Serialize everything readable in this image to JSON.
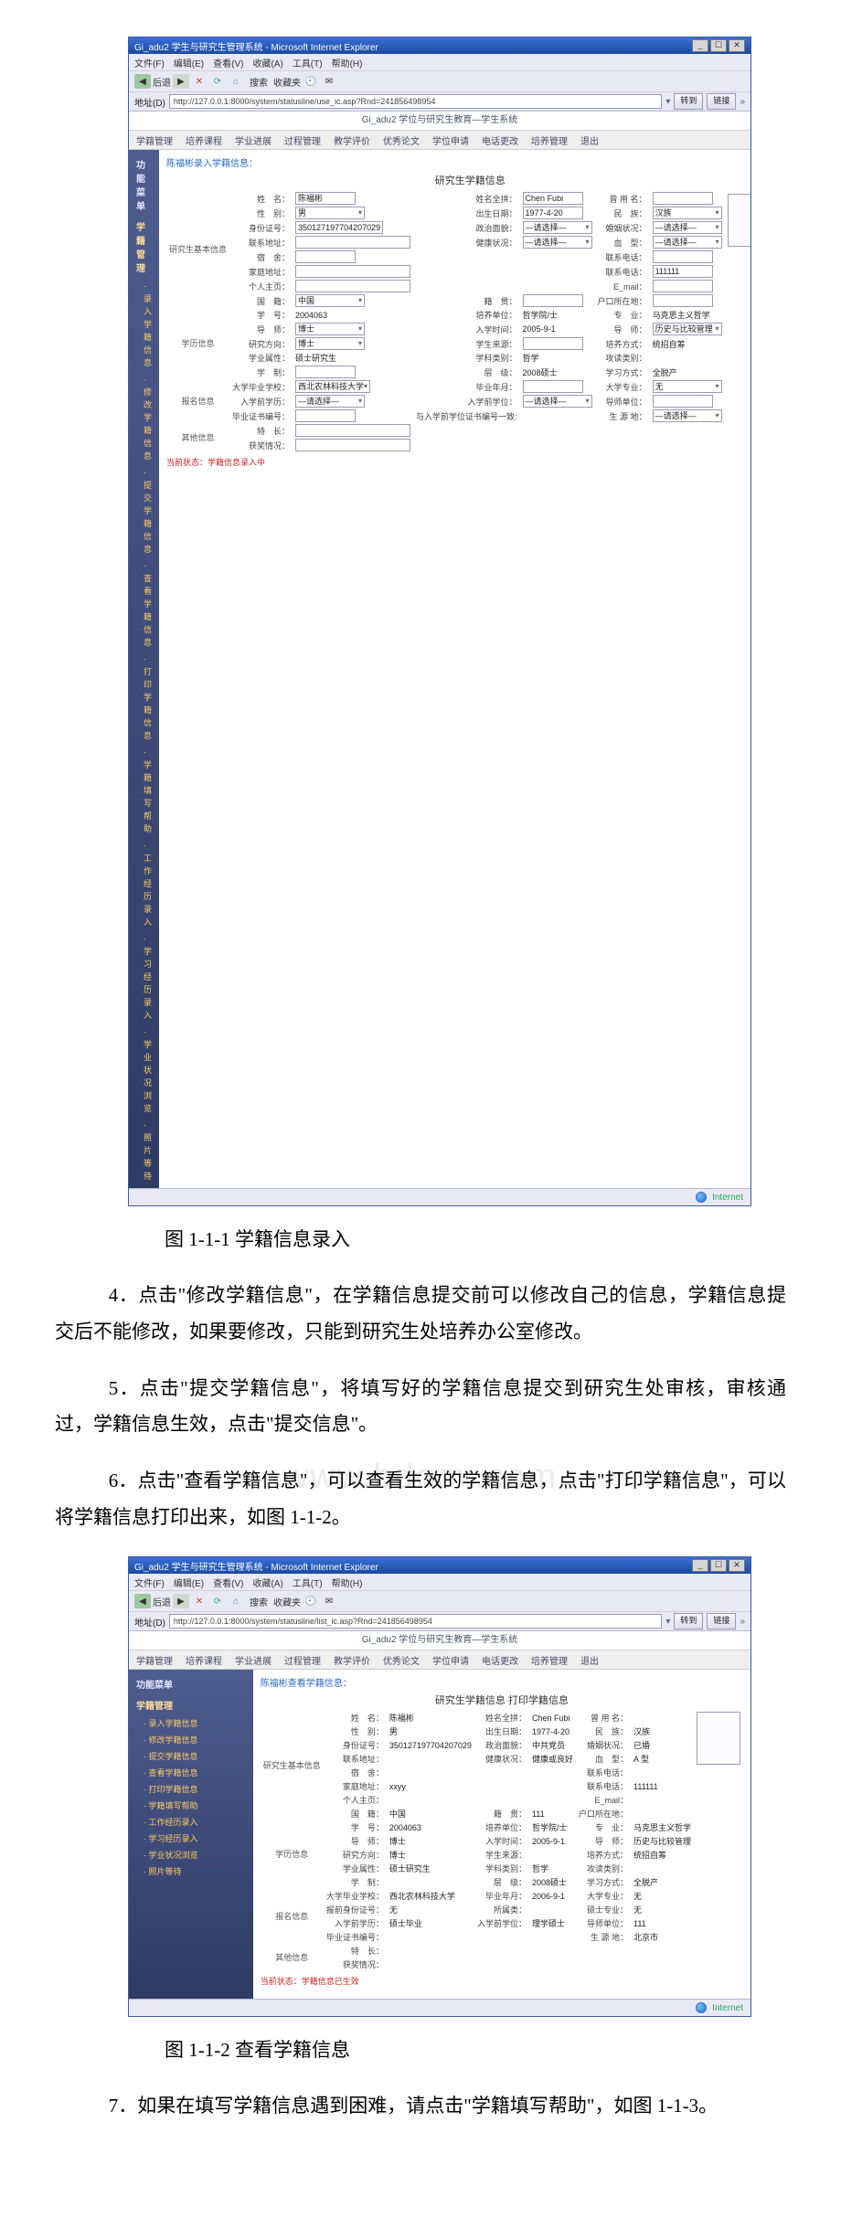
{
  "watermark": "www.bdocx.com",
  "captions": {
    "fig1": "图 1-1-1 学籍信息录入",
    "fig2": "图 1-1-2 查看学籍信息"
  },
  "paragraphs": {
    "p4": "4．点击\"修改学籍信息\"，在学籍信息提交前可以修改自己的信息，学籍信息提交后不能修改，如果要修改，只能到研究生处培养办公室修改。",
    "p5": "5．点击\"提交学籍信息\"，将填写好的学籍信息提交到研究生处审核，审核通过，学籍信息生效，点击\"提交信息\"。",
    "p6": "6．点击\"查看学籍信息\"，可以查看生效的学籍信息，点击\"打印学籍信息\"，可以将学籍信息打印出来，如图 1-1-2。",
    "p7": "7．如果在填写学籍信息遇到困难，请点击\"学籍填写帮助\"，如图 1-1-3。"
  },
  "shot_common": {
    "title": "Gi_adu2 学生与研究生管理系统 - Microsoft Internet Explorer",
    "menus": [
      "文件(F)",
      "编辑(E)",
      "查看(V)",
      "收藏(A)",
      "工具(T)",
      "帮助(H)"
    ],
    "toolbar": [
      "后退",
      "·",
      "⟳",
      "⟲",
      "✕",
      "搜索",
      "收藏夹",
      "·",
      "·",
      "·"
    ],
    "addr_label": "地址(D)",
    "go_btn": "转到",
    "links_btn": "链接",
    "subheader": "Gi_adu2 学位与研究生教育—学生系统",
    "tabs": [
      "学籍管理",
      "培养课程",
      "学业进展",
      "过程管理",
      "教学评价",
      "优秀论文",
      "学位申请",
      "电话更改",
      "培养管理",
      "退出"
    ],
    "sidebar_title": "功能菜单",
    "statusbar": "Internet"
  },
  "shot1": {
    "topnote": "陈福彬录入学籍信息：",
    "sidebar_group": "学籍管理",
    "sidebar_items": [
      "录入学籍信息",
      "修改学籍信息",
      "提交学籍信息",
      "查看学籍信息",
      "打印学籍信息",
      "学籍填写帮助",
      "工作经历录入",
      "学习经历录入",
      "学业状况浏览",
      "照片等待"
    ],
    "form_title": "研究生学籍信息",
    "row_labels": {
      "vl1": "研究生基本信息",
      "vl2": "学历信息",
      "vl3": "报名信息",
      "vl4": "其他信息"
    },
    "rows": [
      [
        [
          "姓　名：",
          "陈福彬",
          "input"
        ],
        [
          "姓名全拼：",
          "Chen Fubi",
          "input"
        ],
        [
          "曾 用 名：",
          "",
          "input"
        ]
      ],
      [
        [
          "性　别：",
          "男",
          "select"
        ],
        [
          "出生日期：",
          "1977-4-20",
          "input"
        ],
        [
          "民　族：",
          "汉族",
          "select"
        ]
      ],
      [
        [
          "身份证号：",
          "350127197704207029",
          "input"
        ],
        [
          "政治面貌：",
          "—请选择—",
          "select"
        ],
        [
          "婚姻状况：",
          "—请选择—",
          "select"
        ]
      ],
      [
        [
          "联系地址：",
          "",
          "input-wide"
        ],
        [
          "健康状况：",
          "—请选择—",
          "select"
        ],
        [
          "血　型：",
          "—请选择—",
          "select"
        ]
      ],
      [
        [
          "宿　舍：",
          "",
          "input"
        ],
        [
          "",
          "",
          ""
        ],
        [
          "联系电话：",
          "",
          "input"
        ]
      ],
      [
        [
          "家庭地址：",
          "",
          "input-wide"
        ],
        [
          "",
          "",
          ""
        ],
        [
          "联系电话：",
          "111111",
          "input"
        ]
      ],
      [
        [
          "个人主页：",
          "",
          "input-wide"
        ],
        [
          "",
          "",
          ""
        ],
        [
          "E_mail：",
          "",
          "input"
        ]
      ],
      [
        [
          "国　籍：",
          "中国",
          "select"
        ],
        [
          "籍　贯：",
          "",
          "input"
        ],
        [
          "户口所在地：",
          "",
          "input"
        ]
      ],
      [
        [
          "学　号：",
          "2004063",
          "text"
        ],
        [
          "培养单位：",
          "哲学院/士",
          "text"
        ],
        [
          "专　业：",
          "马克思主义哲学",
          "text"
        ]
      ],
      [
        [
          "导　师：",
          "博士",
          "select"
        ],
        [
          "入学时间：",
          "2005-9-1",
          "text"
        ],
        [
          "导　师：",
          "历史与比较管理",
          "select"
        ]
      ],
      [
        [
          "研究方向：",
          "博士",
          "select"
        ],
        [
          "学生来源：",
          "",
          "input"
        ],
        [
          "培养方式：",
          "统招自筹",
          "text"
        ]
      ],
      [
        [
          "学业属性：",
          "硕士研究生",
          "text"
        ],
        [
          "学科类别：",
          "哲学",
          "text"
        ],
        [
          "攻读类别：",
          "",
          "text"
        ]
      ],
      [
        [
          "学　制：",
          "",
          "input"
        ],
        [
          "层　级：",
          "2008硕士",
          "text"
        ],
        [
          "学习方式：",
          "全脱产",
          "text"
        ]
      ],
      [
        [
          "大学毕业学校：",
          "西北农林科技大学",
          "select"
        ],
        [
          "毕业年月：",
          "",
          "input"
        ],
        [
          "大学专业：",
          "无",
          "select"
        ]
      ],
      [
        [
          "入学前学历：",
          "—请选择—",
          "select"
        ],
        [
          "入学前学位：",
          "—请选择—",
          "select"
        ],
        [
          "导师单位：",
          "",
          "input"
        ]
      ],
      [
        [
          "毕业证书编号：",
          "",
          "input"
        ],
        [
          "与入学前学位证书编号一致:",
          "",
          "text"
        ],
        [
          "生 源 地：",
          "—请选择—",
          "select"
        ]
      ],
      [
        [
          "特　长：",
          "",
          "input-wide"
        ],
        [
          "",
          "",
          ""
        ],
        [
          "",
          "",
          ""
        ]
      ],
      [
        [
          "获奖情况：",
          "",
          "input-wide"
        ],
        [
          "",
          "",
          ""
        ],
        [
          "",
          "",
          ""
        ]
      ]
    ],
    "bottom_note": "当前状态：学籍信息录入中"
  },
  "shot2": {
    "topnote": "陈福彬查看学籍信息：",
    "sidebar_group": "学籍管理",
    "sidebar_items": [
      "录入学籍信息",
      "修改学籍信息",
      "提交学籍信息",
      "查看学籍信息",
      "打印学籍信息",
      "学籍填写帮助",
      "工作经历录入",
      "学习经历录入",
      "学业状况浏览",
      "照片等待"
    ],
    "form_title": "研究生学籍信息 打印学籍信息",
    "row_labels": {
      "vl1": "研究生基本信息",
      "vl2": "学历信息",
      "vl3": "报名信息",
      "vl4": "其他信息"
    },
    "rows": [
      [
        [
          "姓　名：",
          "陈福彬"
        ],
        [
          "姓名全拼：",
          "Chen Fubi"
        ],
        [
          "曾 用 名：",
          ""
        ]
      ],
      [
        [
          "性　别：",
          "男"
        ],
        [
          "出生日期：",
          "1977-4-20"
        ],
        [
          "民　族：",
          "汉族"
        ]
      ],
      [
        [
          "身份证号：",
          "350127197704207029"
        ],
        [
          "政治面貌：",
          "中共党员"
        ],
        [
          "婚姻状况：",
          "已婚"
        ]
      ],
      [
        [
          "联系地址：",
          ""
        ],
        [
          "健康状况：",
          "健康或良好"
        ],
        [
          "血　型：",
          "A 型"
        ]
      ],
      [
        [
          "宿　舍：",
          ""
        ],
        [
          "",
          ""
        ],
        [
          "联系电话：",
          ""
        ]
      ],
      [
        [
          "家庭地址：",
          "xxyy"
        ],
        [
          "",
          ""
        ],
        [
          "联系电话：",
          "111111"
        ]
      ],
      [
        [
          "个人主页：",
          ""
        ],
        [
          "",
          ""
        ],
        [
          "E_mail：",
          ""
        ]
      ],
      [
        [
          "国　籍：",
          "中国"
        ],
        [
          "籍　贯：",
          "111"
        ],
        [
          "户口所在地：",
          ""
        ]
      ],
      [
        [
          "学　号：",
          "2004063"
        ],
        [
          "培养单位：",
          "哲学院/士"
        ],
        [
          "专　业：",
          "马克思主义哲学"
        ]
      ],
      [
        [
          "导　师：",
          "博士"
        ],
        [
          "入学时间：",
          "2005-9-1"
        ],
        [
          "导　师：",
          "历史与比较管理"
        ]
      ],
      [
        [
          "研究方向：",
          "博士"
        ],
        [
          "学生来源：",
          ""
        ],
        [
          "培养方式：",
          "统招自筹"
        ]
      ],
      [
        [
          "学业属性：",
          "硕士研究生"
        ],
        [
          "学科类别：",
          "哲学"
        ],
        [
          "攻读类别：",
          ""
        ]
      ],
      [
        [
          "学　制：",
          ""
        ],
        [
          "层　级：",
          "2008硕士"
        ],
        [
          "学习方式：",
          "全脱产"
        ]
      ],
      [
        [
          "大学毕业学校：",
          "西北农林科技大学"
        ],
        [
          "毕业年月：",
          "2006-9-1"
        ],
        [
          "大学专业：",
          "无"
        ]
      ],
      [
        [
          "报前身份证号：",
          "无"
        ],
        [
          "所属类：",
          ""
        ],
        [
          "硕士专业：",
          "无"
        ]
      ],
      [
        [
          "入学前学历：",
          "硕士毕业"
        ],
        [
          "入学前学位：",
          "理学硕士"
        ],
        [
          "导师单位：",
          "111"
        ]
      ],
      [
        [
          "毕业证书编号：",
          ""
        ],
        [
          "",
          ""
        ],
        [
          "生 源 地：",
          "北京市"
        ]
      ],
      [
        [
          "特　长：",
          ""
        ],
        [
          "",
          ""
        ],
        [
          "",
          ""
        ]
      ],
      [
        [
          "获奖情况：",
          ""
        ],
        [
          "",
          ""
        ],
        [
          "",
          ""
        ]
      ]
    ],
    "bottom_note": "当前状态：学籍信息已生效"
  }
}
